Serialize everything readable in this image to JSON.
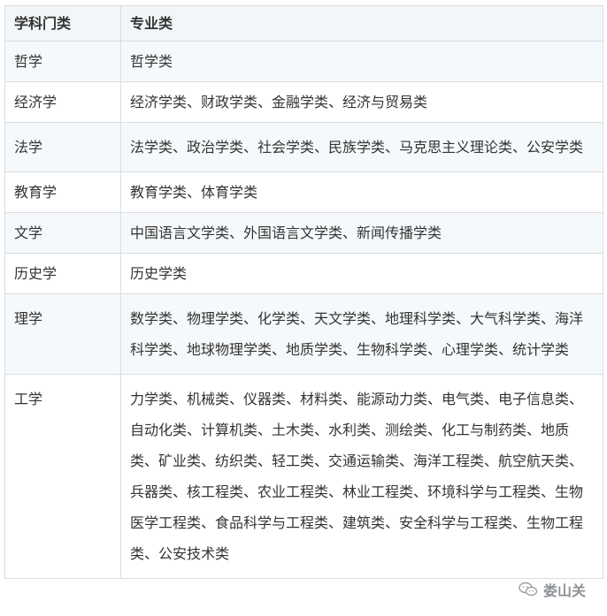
{
  "table": {
    "headers": [
      "学科门类",
      "专业类"
    ],
    "rows": [
      {
        "category": "哲学",
        "majors": "哲学类"
      },
      {
        "category": "经济学",
        "majors": "经济学类、财政学类、金融学类、经济与贸易类"
      },
      {
        "category": "法学",
        "majors": "法学类、政治学类、社会学类、民族学类、马克思主义理论类、公安学类"
      },
      {
        "category": "教育学",
        "majors": "教育学类、体育学类"
      },
      {
        "category": "文学",
        "majors": "中国语言文学类、外国语言文学类、新闻传播学类"
      },
      {
        "category": "历史学",
        "majors": "历史学类"
      },
      {
        "category": "理学",
        "majors": "数学类、物理学类、化学类、天文学类、地理科学类、大气科学类、海洋科学类、地球物理学类、地质学类、生物科学类、心理学类、统计学类"
      },
      {
        "category": "工学",
        "majors": "力学类、机械类、仪器类、材料类、能源动力类、电气类、电子信息类、自动化类、计算机类、土木类、水利类、测绘类、化工与制药类、地质类、矿业类、纺织类、轻工类、交通运输类、海洋工程类、航空航天类、兵器类、核工程类、农业工程类、林业工程类、环境科学与工程类、生物医学工程类、食品科学与工程类、建筑类、安全科学与工程类、生物工程类、公安技术类"
      }
    ]
  },
  "watermark": {
    "text": "娄山关",
    "icon": "wechat-icon"
  }
}
